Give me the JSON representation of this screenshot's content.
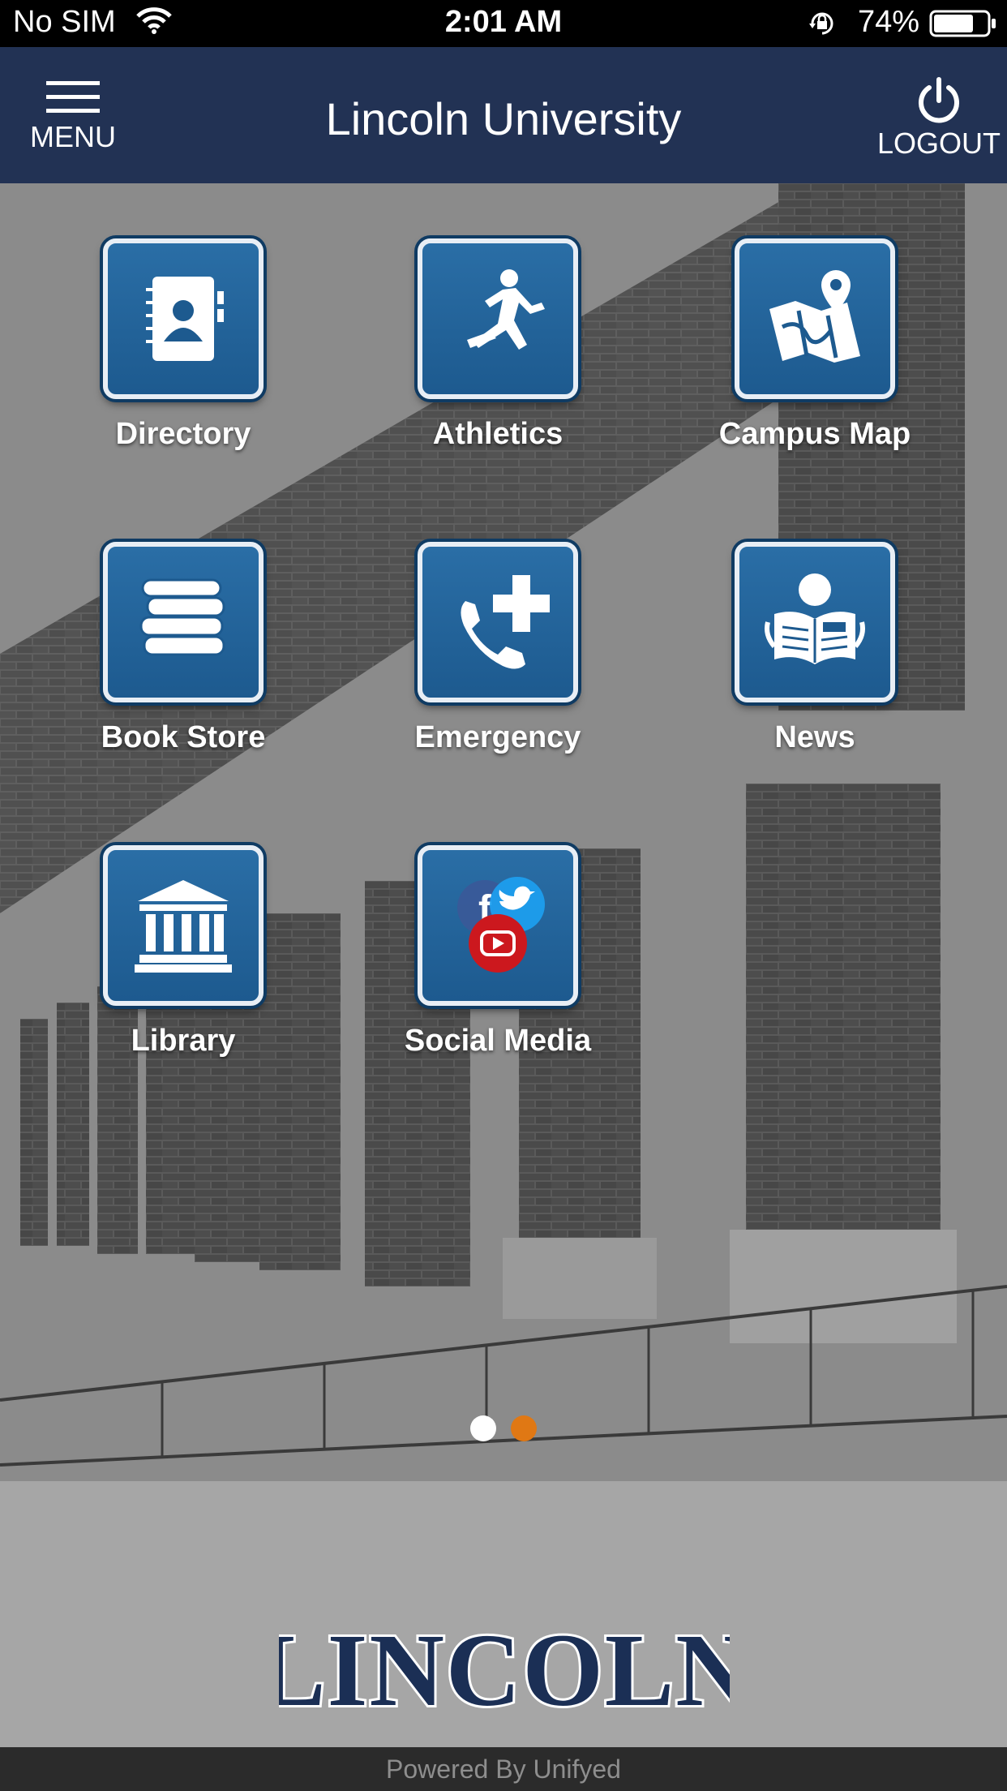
{
  "status_bar": {
    "carrier": "No SIM",
    "time": "2:01 AM",
    "battery": "74%",
    "icons": [
      "wifi-icon",
      "orientation-lock-icon",
      "battery-icon"
    ]
  },
  "header": {
    "menu_label": "MENU",
    "title": "Lincoln University",
    "logout_label": "LOGOUT"
  },
  "tiles": [
    {
      "label": "Directory",
      "icon": "address-book-icon"
    },
    {
      "label": "Athletics",
      "icon": "runner-icon"
    },
    {
      "label": "Campus Map",
      "icon": "map-pin-icon"
    },
    {
      "label": "Book Store",
      "icon": "books-icon"
    },
    {
      "label": "Emergency",
      "icon": "phone-plus-icon"
    },
    {
      "label": "News",
      "icon": "newspaper-reader-icon"
    },
    {
      "label": "Library",
      "icon": "library-building-icon"
    },
    {
      "label": "Social Media",
      "icon": "social-media-icon"
    }
  ],
  "pagination": {
    "pages": 2,
    "current_page": 2
  },
  "logo_text": "LINCOLN",
  "footer": {
    "powered_by": "Powered By Unifyed"
  },
  "colors": {
    "header_bg": "#223254",
    "tile_blue": "#1d5a8f",
    "dot_active": "#e07814",
    "dot_inactive": "#ffffff",
    "logo_navy": "#1b2f55"
  }
}
